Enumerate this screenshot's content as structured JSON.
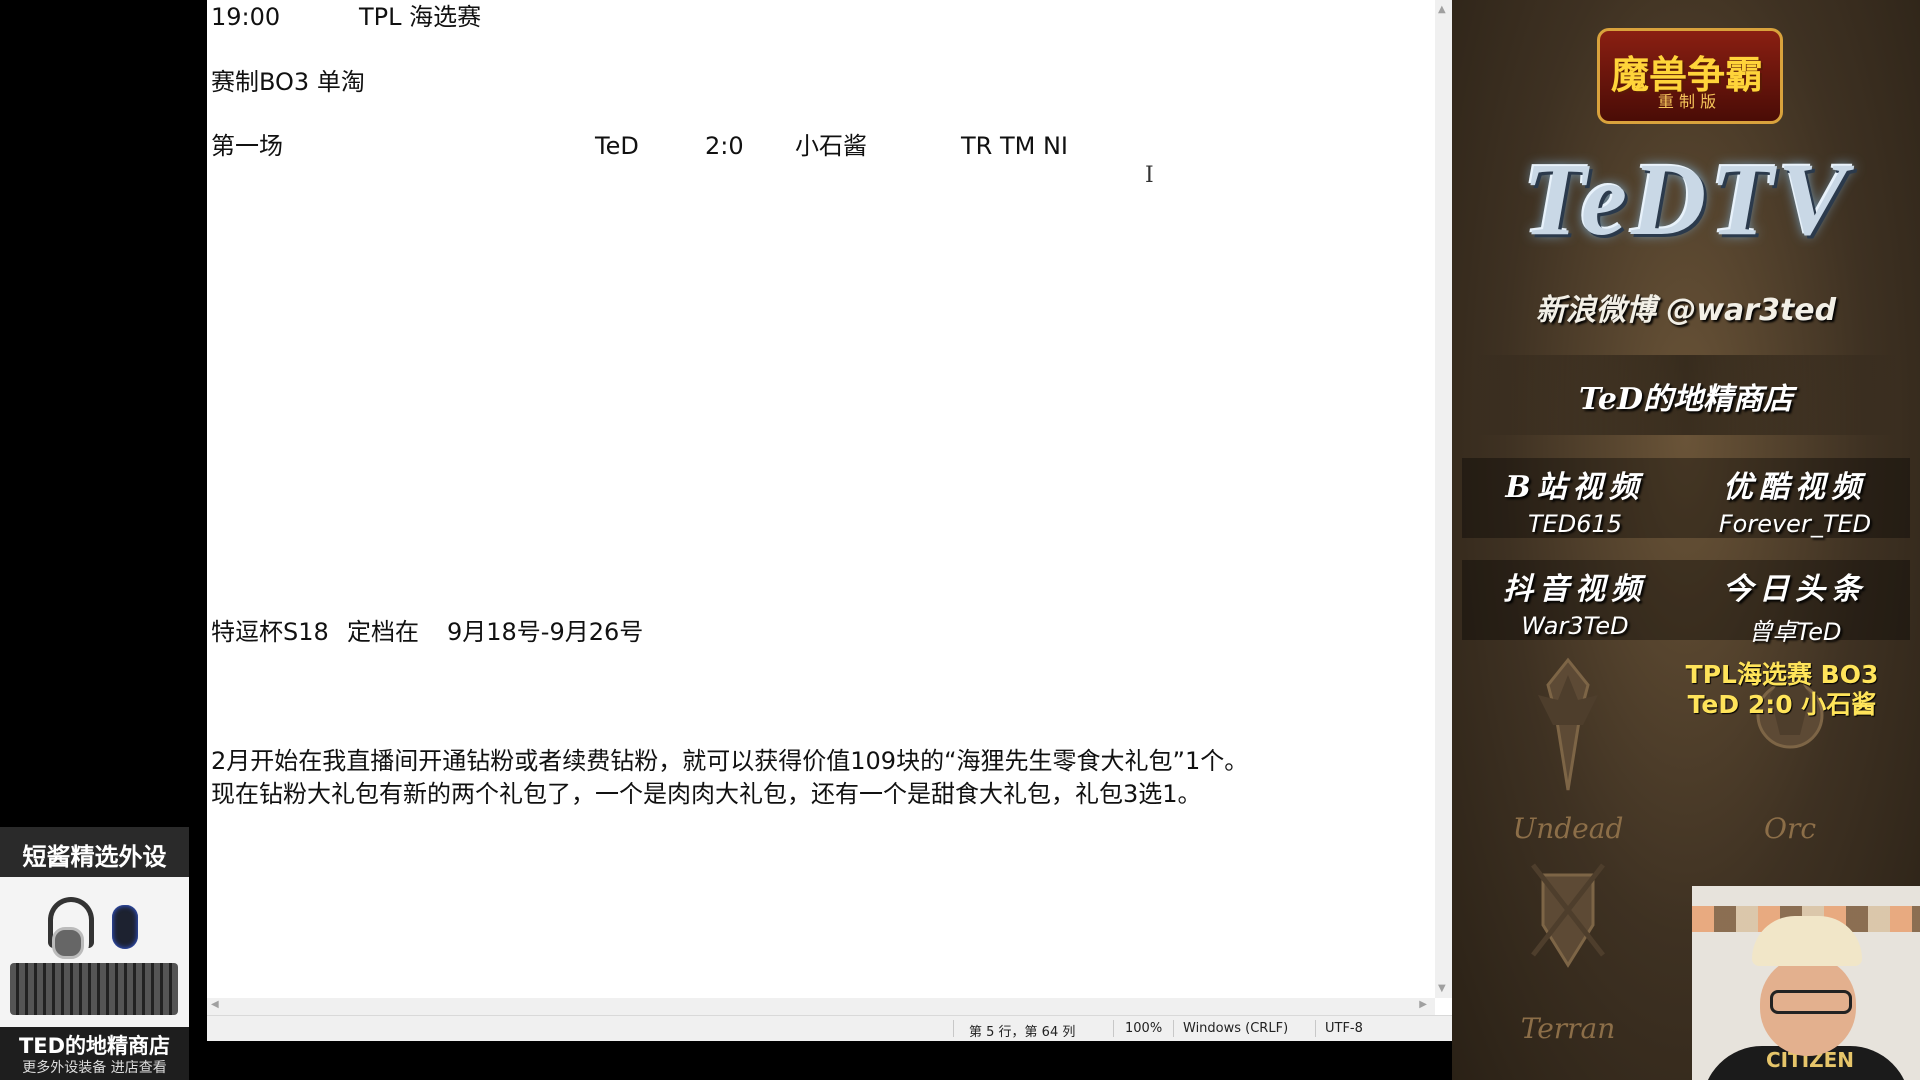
{
  "editor": {
    "lines": [
      {
        "a": "19:00",
        "b": "TPL 海选赛"
      },
      {
        "a": "赛制BO3  单淘"
      },
      {
        "a": "第一场",
        "player1": "TeD",
        "score": "2:0",
        "player2": "小石酱",
        "races": "TR TM NI"
      },
      {
        "a": "特逗杯S18",
        "b": "定档在",
        "c": "9月18号-9月26号"
      },
      {
        "a": "2月开始在我直播间开通钻粉或者续费钻粉，就可以获得价值109块的“海狸先生零食大礼包”1个。"
      },
      {
        "a": "现在钻粉大礼包有新的两个礼包了，一个是肉肉大礼包，还有一个是甜食大礼包，礼包3选1。"
      }
    ]
  },
  "statusbar": {
    "position": "第 5 行，第 64 列",
    "zoom": "100%",
    "line_ending": "Windows (CRLF)",
    "encoding": "UTF-8"
  },
  "overlay": {
    "game_logo_title": "魔兽争霸",
    "game_logo_sub": "重 制 版",
    "brand": "TeDTV",
    "weibo": "新浪微博 @war3ted",
    "shop": "TeD的地精商店",
    "videos": [
      {
        "head": "B站视频",
        "account": "TED615"
      },
      {
        "head": "优酷视频",
        "account": "Forever_TED"
      },
      {
        "head": "抖音视频",
        "account": "War3TeD"
      },
      {
        "head": "今日头条",
        "account": "曾卓TeD"
      }
    ],
    "match_line1": "TPL海选赛 BO3",
    "match_line2": "TeD 2:0 小石酱",
    "races": [
      "Undead",
      "Orc",
      "Terran"
    ]
  },
  "webcam": {
    "shirt_text": "CITIZEN"
  },
  "shop_ad": {
    "title": "短酱精选外设",
    "bottom_title": "TED的地精商店",
    "bottom_sub": "更多外设装备 进店查看"
  }
}
